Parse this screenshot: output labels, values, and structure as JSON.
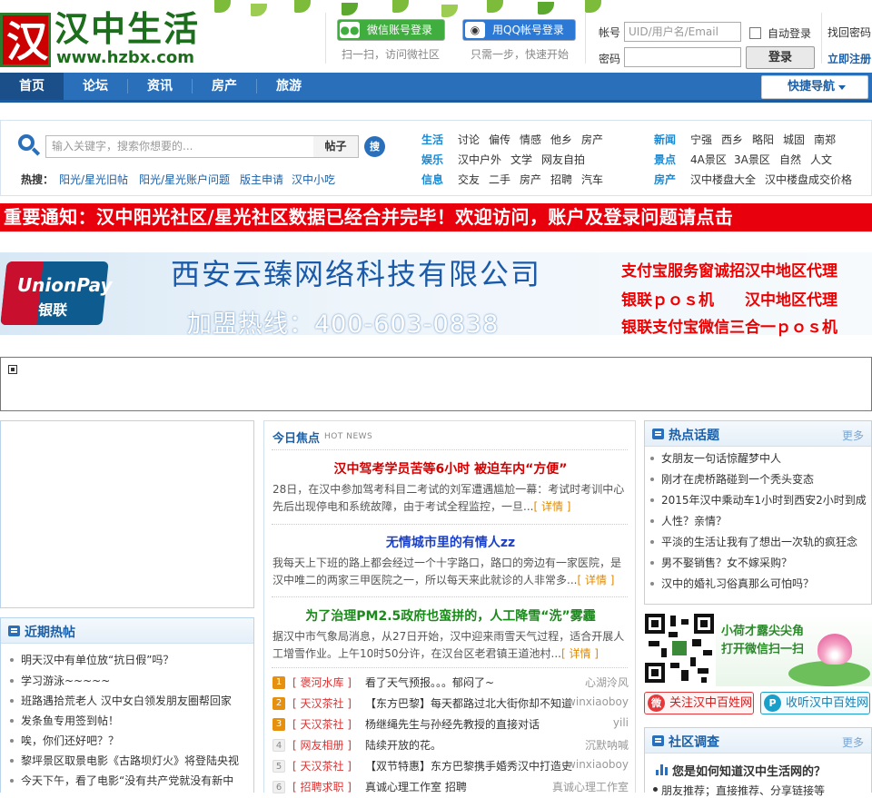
{
  "header": {
    "logo_text": "汉中生活",
    "logo_url": "www.hzbx.com",
    "logo_glyph": "汉",
    "wechat_login": "微信账号登录",
    "wechat_hint": "扫一扫，访问微社区",
    "qq_login": "用QQ帐号登录",
    "qq_hint": "只需一步，快速开始",
    "account_label": "帐号",
    "account_placeholder": "UID/用户名/Email",
    "password_label": "密码",
    "remember_label": "自动登录",
    "login_button": "登录",
    "forgot_link": "找回密码",
    "register_link": "立即注册"
  },
  "nav": {
    "items": [
      "首页",
      "论坛",
      "资讯",
      "房产",
      "旅游"
    ],
    "quick_nav": "快捷导航"
  },
  "search": {
    "placeholder": "输入关键字，搜索你想要的...",
    "type": "帖子",
    "go": "搜",
    "hot_label": "热搜：",
    "hot": [
      "阳光/星光旧帖",
      "阳光/星光账户问题",
      "版主申请",
      "汉中小吃"
    ]
  },
  "categories": {
    "left": [
      {
        "head": "生活",
        "links": [
          "讨论",
          "偏传",
          "情感",
          "他乡",
          "房产"
        ]
      },
      {
        "head": "娱乐",
        "links": [
          "汉中户外",
          "文学",
          "网友自拍"
        ]
      },
      {
        "head": "信息",
        "links": [
          "交友",
          "二手",
          "房产",
          "招聘",
          "汽车"
        ]
      }
    ],
    "right": [
      {
        "head": "新闻",
        "links": [
          "宁强",
          "西乡",
          "略阳",
          "城固",
          "南郑"
        ]
      },
      {
        "head": "景点",
        "links": [
          "4A景区",
          "3A景区",
          "自然",
          "人文"
        ]
      },
      {
        "head": "房产",
        "links": [
          "汉中楼盘大全",
          "汉中楼盘成交价格"
        ]
      }
    ]
  },
  "notice": "重要通知：汉中阳光社区/星光社区数据已经合并完毕！欢迎访问，账户及登录问题请点击",
  "banner": {
    "unionpay": "UnionPay",
    "unionpay_cn": "银联",
    "company": "西安云臻网络科技有限公司",
    "hotline": "加盟热线：400-603-0838",
    "right_lines": [
      "支付宝服务窗诚招汉中地区代理",
      "银联ｐｏｓ机　　汉中地区代理",
      "银联支付宝微信三合一ｐｏｓ机"
    ]
  },
  "recent_hot": {
    "title": "近期热帖",
    "items": [
      "明天汉中有单位放“抗日假”吗？",
      "学习游泳~~~~~",
      "班路遇拾荒老人 汉中女白领发朋友圈帮回家",
      "发条鱼专用签到帖！",
      "唉，你们还好吧？？",
      "黎坪景区取景电影《古路坝灯火》将登陆央视",
      "今天下午，看了电影“没有共产党就没有新中"
    ]
  },
  "today": {
    "title": "今日焦点",
    "subtitle": "HOT NEWS",
    "read_more": "[ 详情 ]",
    "articles": [
      {
        "headline": "汉中驾考学员苦等6小时 被迫车内“方便”",
        "body": "28日，在汉中参加驾考科目二考试的刘军遭遇尴尬一幕：考试时考训中心先后出现停电和系统故障，由于考试全程监控，一旦...",
        "color": "#d40000"
      },
      {
        "headline": "无情城市里的有情人zz",
        "body": "我每天上下班的路上都会经过一个十字路口，路口的旁边有一家医院，是汉中唯二的两家三甲医院之一，所以每天来此就诊的人非常多...",
        "color": "#1a3fc8"
      },
      {
        "headline": "为了治理PM2.5政府也蛮拼的，人工降雪“洗”雾霾",
        "body": "据汉中市气象局消息，从27日开始，汉中迎来雨雪天气过程，适合开展人工增雪作业。上午10时50分许，在汉台区老君镇王道池村...",
        "color": "#1a8a1a"
      }
    ],
    "ranks": [
      {
        "num": "1",
        "cat": "[ 褒河水库 ]",
        "title": "看了天气预报。。。郁闷了~",
        "author": "心湖泠风"
      },
      {
        "num": "2",
        "cat": "[ 天汉茶社 ]",
        "title": "【东方巴黎】每天都路过北大街你却不知道",
        "author": "winxiaoboy"
      },
      {
        "num": "3",
        "cat": "[ 天汉茶社 ]",
        "title": "杨继绳先生与孙经先教授的直接对话",
        "author": "yili"
      },
      {
        "num": "4",
        "cat": "[ 网友相册 ]",
        "title": "陆续开放的花。",
        "author": "沉默呐喊"
      },
      {
        "num": "5",
        "cat": "[ 天汉茶社 ]",
        "title": "【双节特惠】东方巴黎携手婚秀汉中打造史",
        "author": "winxiaoboy"
      },
      {
        "num": "6",
        "cat": "[ 招聘求职 ]",
        "title": "真诚心理工作室 招聘",
        "author": "真诚心理工作室"
      }
    ]
  },
  "hot_topics": {
    "title": "热点话题",
    "more": "更多",
    "items": [
      "女朋友一句话惊醒梦中人",
      "刚才在虎桥路碰到一个秃头变态",
      "2015年汉中乘动车1小时到西安2小时到成",
      "人性？亲情？",
      "平淡的生活让我有了想出一次轨的疯狂念",
      "男不娶销售？女不嫁采购？",
      "汉中的婚礼习俗真那么可怕吗？"
    ]
  },
  "promo": {
    "line1": "小荷才露尖尖角",
    "line2": "打开微信扫一扫",
    "weibo": "关注汉中百姓网",
    "radio": "收听汉中百姓网"
  },
  "survey": {
    "title": "社区调查",
    "more": "更多",
    "question": "您是如何知道汉中生活网的？",
    "option": "朋友推荐；直接推荐、分享链接等"
  }
}
